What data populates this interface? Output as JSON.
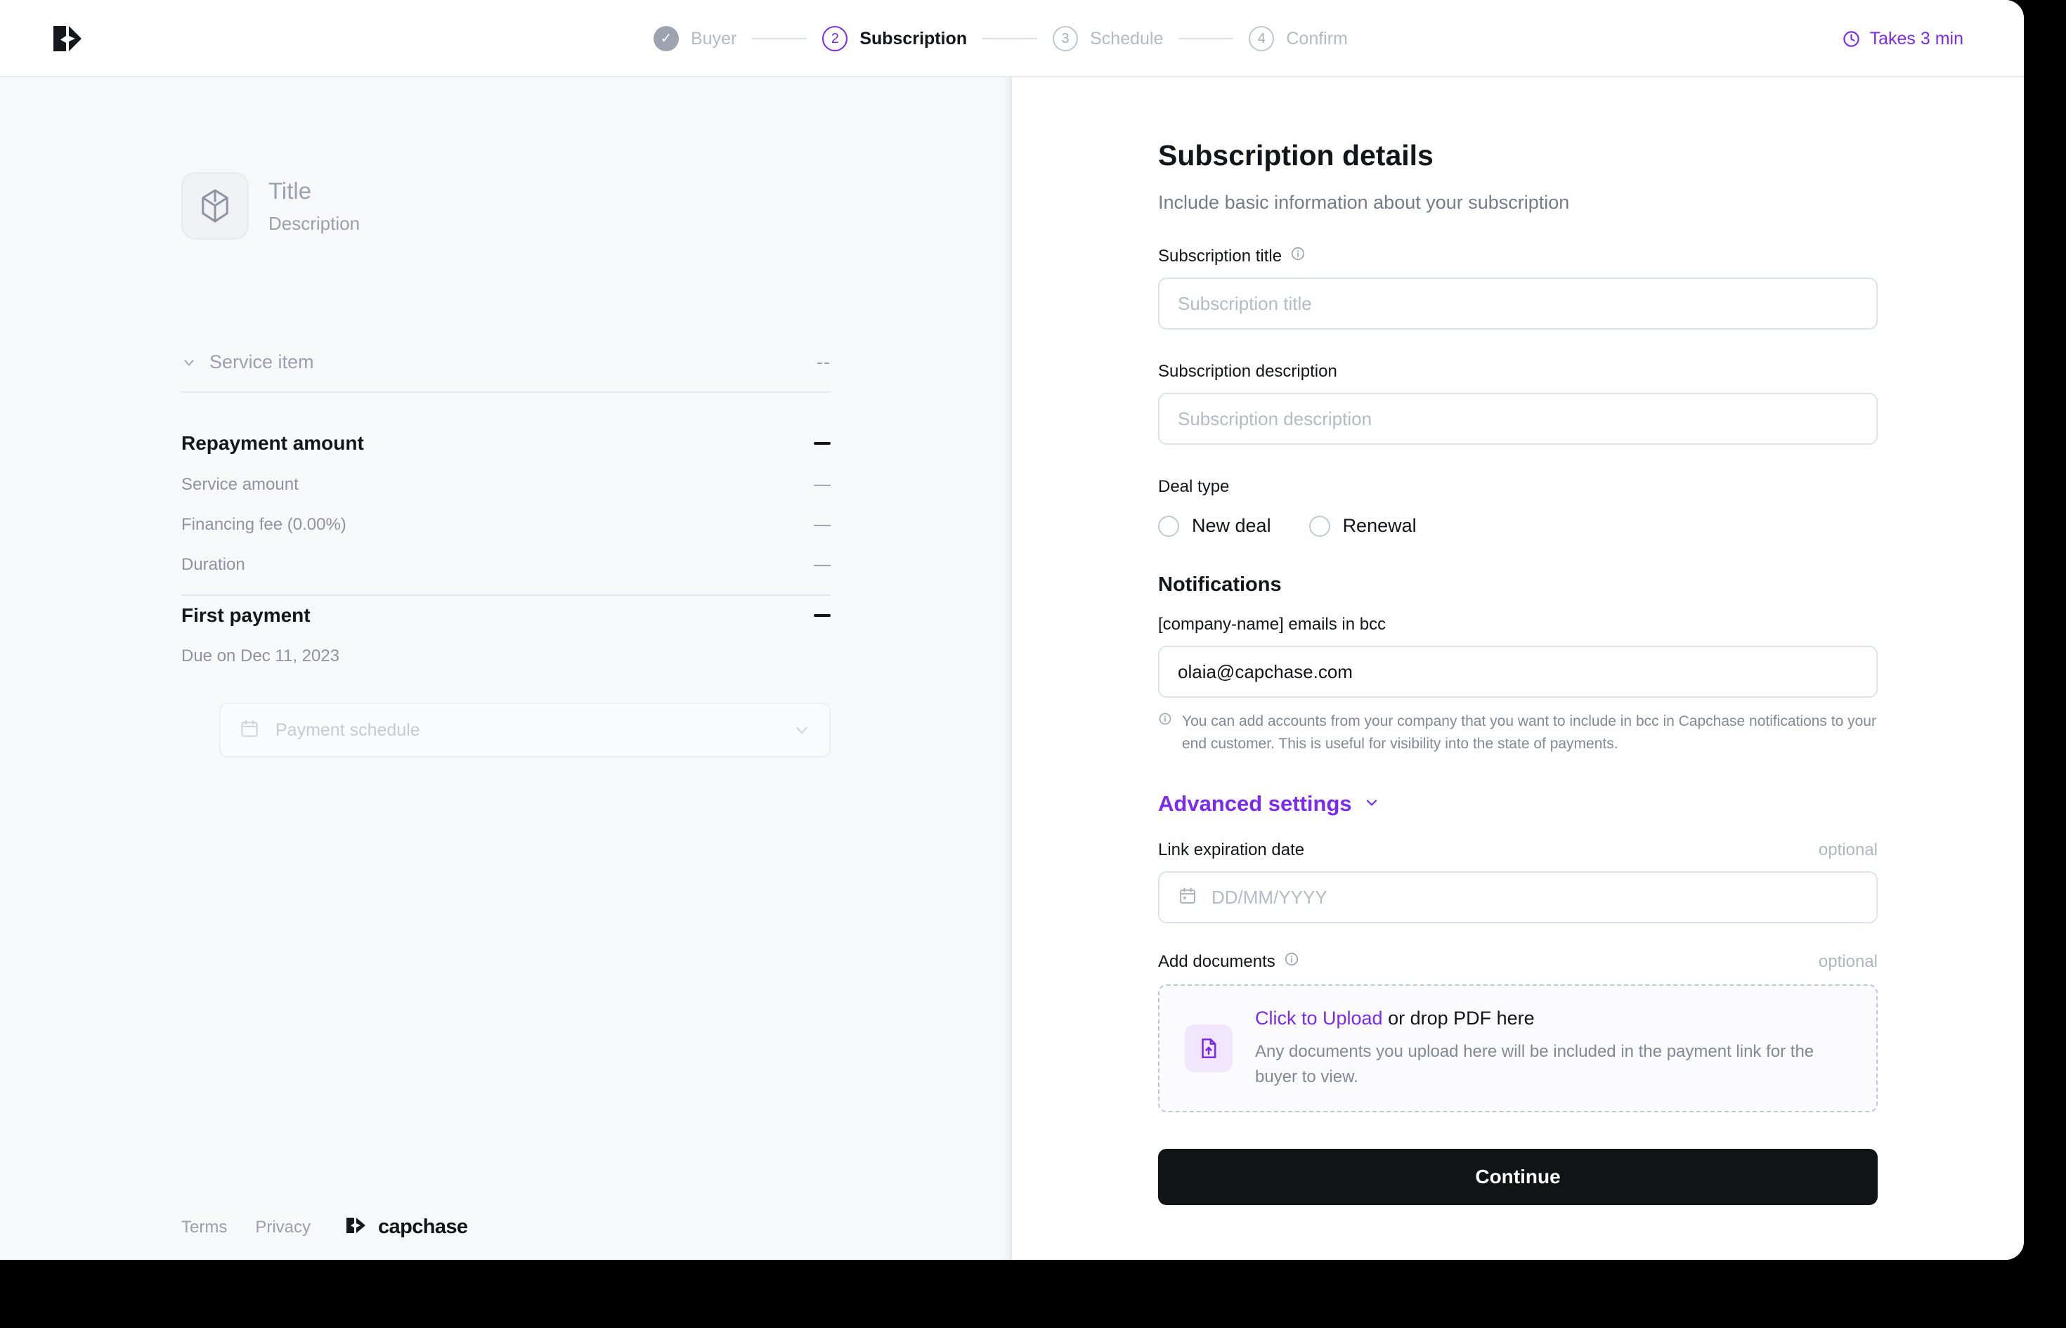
{
  "brand": {
    "name": "capchase",
    "logo_icon": "capchase-chevrons-icon"
  },
  "topbar": {
    "steps": [
      {
        "number": "1",
        "label": "Buyer",
        "state": "done",
        "marker": "✓"
      },
      {
        "number": "2",
        "label": "Subscription",
        "state": "current",
        "marker": "2"
      },
      {
        "number": "3",
        "label": "Schedule",
        "state": "upcoming",
        "marker": "3"
      },
      {
        "number": "4",
        "label": "Confirm",
        "state": "upcoming",
        "marker": "4"
      }
    ],
    "takes_label": "Takes 3 min",
    "clock_icon": "clock-icon",
    "accent_color": "#7c29f0"
  },
  "summary": {
    "icon": "cube-icon",
    "title": "Title",
    "description": "Description",
    "service_item": {
      "label": "Service item",
      "value": "--",
      "chevron_icon": "chevron-down-icon"
    },
    "repayment": {
      "title": "Repayment amount",
      "collapse_icon": "minus-icon",
      "rows": [
        {
          "label": "Service amount",
          "value": "—"
        },
        {
          "label": "Financing fee (0.00%)",
          "value": "—"
        },
        {
          "label": "Duration",
          "value": "—"
        }
      ]
    },
    "first_payment": {
      "title": "First payment",
      "collapse_icon": "minus-icon",
      "due": "Due on Dec 11, 2023"
    },
    "payment_schedule": {
      "placeholder": "Payment schedule",
      "calendar_icon": "calendar-icon",
      "chevron_icon": "chevron-down-icon"
    }
  },
  "footer": {
    "terms": "Terms",
    "privacy": "Privacy",
    "wordmark": "capchase"
  },
  "form": {
    "title": "Subscription details",
    "subtitle": "Include basic information about your subscription",
    "subscription_title": {
      "label": "Subscription title",
      "info_icon": "info-icon",
      "placeholder": "Subscription title",
      "value": ""
    },
    "subscription_description": {
      "label": "Subscription description",
      "placeholder": "Subscription description",
      "value": ""
    },
    "deal_type": {
      "label": "Deal type",
      "options": [
        {
          "label": "New deal",
          "selected": false
        },
        {
          "label": "Renewal",
          "selected": false
        }
      ]
    },
    "notifications": {
      "title": "Notifications",
      "bcc_label": "[company-name] emails in bcc",
      "bcc_value": "olaia@capchase.com",
      "hint_icon": "info-icon",
      "hint": "You can add accounts from your company that you want to include in bcc in Capchase notifications to your end customer. This is useful for visibility into the state of payments."
    },
    "advanced_settings": {
      "label": "Advanced settings",
      "chevron_icon": "chevron-down-icon"
    },
    "link_expiration": {
      "label": "Link expiration date",
      "optional": "optional",
      "placeholder": "DD/MM/YYYY",
      "calendar_icon": "calendar-icon",
      "value": ""
    },
    "add_documents": {
      "label": "Add documents",
      "info_icon": "info-icon",
      "optional": "optional",
      "upload_icon": "file-upload-icon",
      "link_text": "Click to Upload",
      "rest_text": " or drop PDF here",
      "sub_text": "Any documents you upload here will be included in the payment link for the buyer to view."
    },
    "continue_label": "Continue"
  }
}
